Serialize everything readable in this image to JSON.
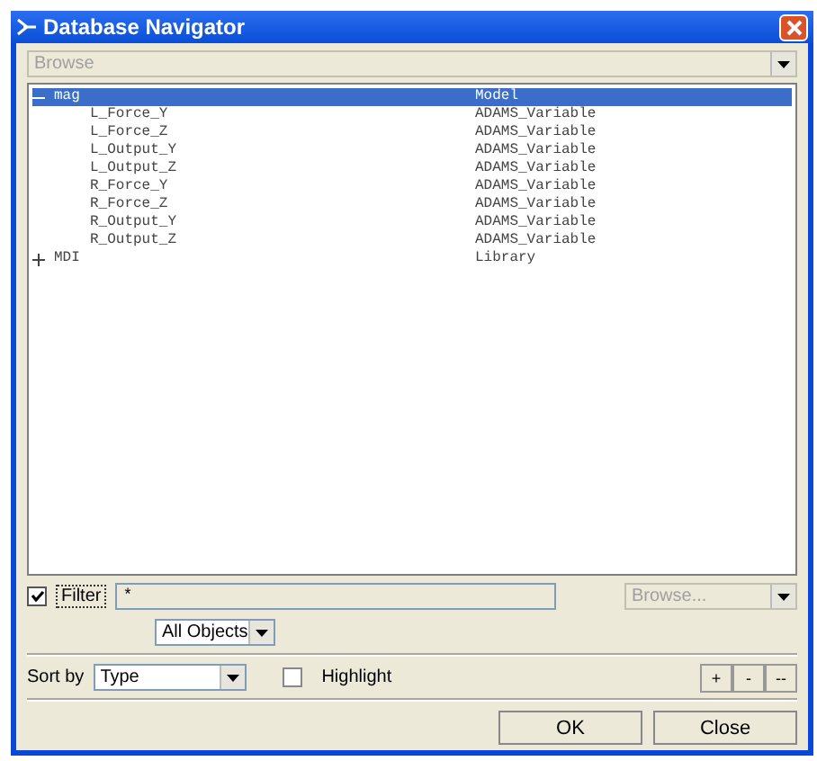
{
  "window": {
    "title": "Database Navigator"
  },
  "mode_combo": {
    "value": "Browse",
    "disabled": true
  },
  "tree": [
    {
      "name": "mag",
      "type": "Model",
      "expanded": true,
      "selected": true,
      "children": [
        {
          "name": "L_Force_Y",
          "type": "ADAMS_Variable",
          "selected": false
        },
        {
          "name": "L_Force_Z",
          "type": "ADAMS_Variable",
          "selected": false
        },
        {
          "name": "L_Output_Y",
          "type": "ADAMS_Variable",
          "selected": false
        },
        {
          "name": "L_Output_Z",
          "type": "ADAMS_Variable",
          "selected": false
        },
        {
          "name": "R_Force_Y",
          "type": "ADAMS_Variable",
          "selected": false
        },
        {
          "name": "R_Force_Z",
          "type": "ADAMS_Variable",
          "selected": false
        },
        {
          "name": "R_Output_Y",
          "type": "ADAMS_Variable",
          "selected": false
        },
        {
          "name": "R_Output_Z",
          "type": "ADAMS_Variable",
          "selected": false
        }
      ]
    },
    {
      "name": "MDI",
      "type": "Library",
      "expanded": false,
      "selected": false
    }
  ],
  "filter": {
    "label": "Filter",
    "checked": true,
    "value": "*",
    "browse": {
      "label": "Browse...",
      "disabled": true
    },
    "type": "All Objects"
  },
  "sort": {
    "label": "Sort by",
    "value": "Type"
  },
  "highlight": {
    "label": "Highlight",
    "checked": false
  },
  "zoom_buttons": [
    "+",
    "-",
    "--"
  ],
  "buttons": [
    "OK",
    "Close"
  ]
}
